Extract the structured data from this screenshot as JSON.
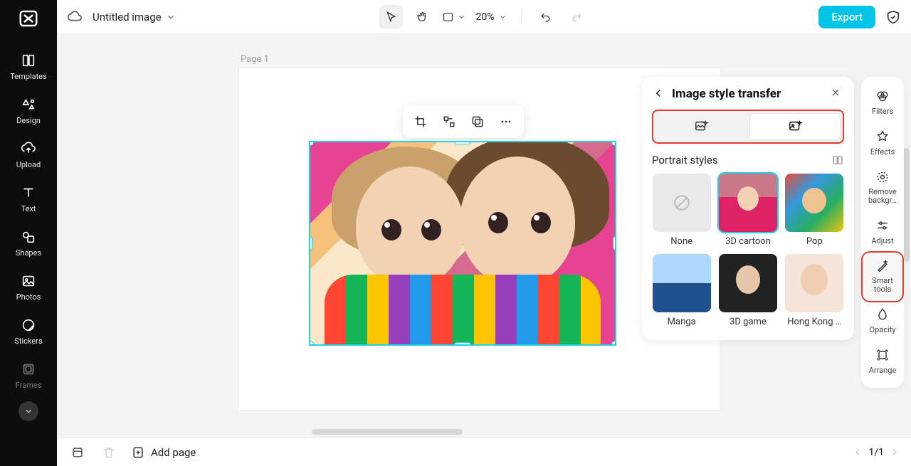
{
  "app": {
    "title": "Untitled image"
  },
  "left_rail": {
    "items": [
      {
        "label": "Templates"
      },
      {
        "label": "Design"
      },
      {
        "label": "Upload"
      },
      {
        "label": "Text"
      },
      {
        "label": "Shapes"
      },
      {
        "label": "Photos"
      },
      {
        "label": "Stickers"
      },
      {
        "label": "Frames"
      }
    ]
  },
  "topbar": {
    "zoom": "20%",
    "export": "Export"
  },
  "canvas": {
    "page_label": "Page 1"
  },
  "style_panel": {
    "title": "Image style transfer",
    "section_title": "Portrait styles",
    "styles": [
      {
        "label": "None"
      },
      {
        "label": "3D cartoon"
      },
      {
        "label": "Pop"
      },
      {
        "label": "Manga"
      },
      {
        "label": "3D game"
      },
      {
        "label": "Hong Kong …"
      }
    ]
  },
  "right_rail": {
    "items": [
      {
        "label": "Filters"
      },
      {
        "label": "Effects"
      },
      {
        "label": "Remove backgr…"
      },
      {
        "label": "Adjust"
      },
      {
        "label": "Smart tools"
      },
      {
        "label": "Opacity"
      },
      {
        "label": "Arrange"
      }
    ]
  },
  "bottom": {
    "add_page": "Add page",
    "page_indicator": "1/1"
  }
}
